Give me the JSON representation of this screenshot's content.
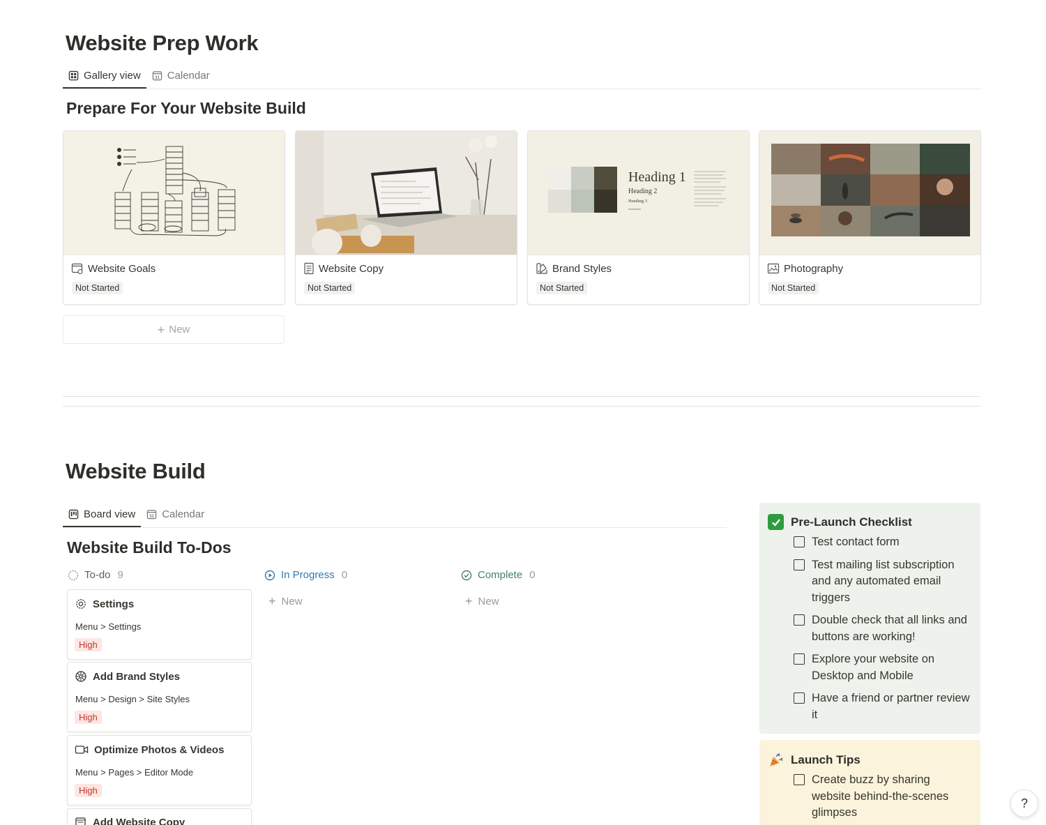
{
  "prep": {
    "title": "Website Prep Work",
    "tabs": [
      {
        "label": "Gallery view",
        "icon": "gallery-icon",
        "active": true
      },
      {
        "label": "Calendar",
        "icon": "calendar-icon",
        "active": false
      }
    ],
    "calendar_icon_num": "31",
    "section_title": "Prepare For Your Website Build",
    "cards": [
      {
        "title": "Website Goals",
        "icon": "calendar-check-icon",
        "status": "Not Started",
        "cover": "sketch-wireframe"
      },
      {
        "title": "Website Copy",
        "icon": "document-icon",
        "status": "Not Started",
        "cover": "laptop-desk-photo"
      },
      {
        "title": "Brand Styles",
        "icon": "swatch-icon",
        "status": "Not Started",
        "cover": "brand-style-guide"
      },
      {
        "title": "Photography",
        "icon": "image-icon",
        "status": "Not Started",
        "cover": "photo-grid"
      }
    ],
    "new_label": "New"
  },
  "build": {
    "title": "Website Build",
    "tabs": [
      {
        "label": "Board view",
        "icon": "board-icon",
        "active": true
      },
      {
        "label": "Calendar",
        "icon": "calendar-icon",
        "active": false
      }
    ],
    "section_title": "Website Build To-Dos",
    "columns": [
      {
        "label": "To-do",
        "count": "9",
        "color": "#787774"
      },
      {
        "label": "In Progress",
        "count": "0",
        "color": "#2e7bb6"
      },
      {
        "label": "Complete",
        "count": "0",
        "color": "#448361"
      }
    ],
    "new_label": "New",
    "cards": [
      {
        "title": "Settings",
        "icon": "gear-icon",
        "path": "Menu > Settings",
        "priority": "High"
      },
      {
        "title": "Add Brand Styles",
        "icon": "palette-icon",
        "path": "Menu > Design > Site Styles",
        "priority": "High"
      },
      {
        "title": "Optimize Photos & Videos",
        "icon": "video-camera-icon",
        "path": "Menu > Pages > Editor Mode",
        "priority": "High"
      },
      {
        "title": "Add Website Copy",
        "icon": "document-icon",
        "path": "",
        "priority": ""
      }
    ]
  },
  "checklist": {
    "title": "Pre-Launch Checklist",
    "icon": "✅",
    "bg": "#edf3ec",
    "items": [
      "Test contact form",
      "Test mailing list subscription and any automated email triggers",
      "Double check that all links and buttons are working!",
      "Explore your website on Desktop and Mobile",
      "Have a friend or partner review it"
    ]
  },
  "tips": {
    "title": "Launch Tips",
    "icon": "🎉",
    "bg": "#fbf3db",
    "items": [
      "Create buzz by sharing website behind-the-scenes glimpses"
    ]
  },
  "brand_cover": {
    "h1": "Heading 1",
    "h2": "Heading 2",
    "h3": "Heading 3"
  },
  "help_label": "?"
}
